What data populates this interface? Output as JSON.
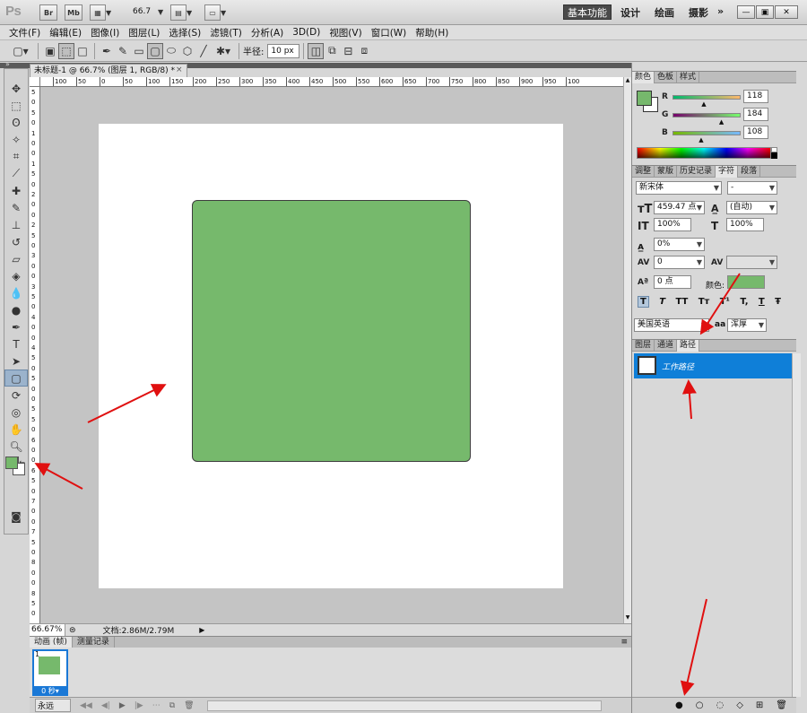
{
  "app": {
    "logo": "Ps",
    "bridge_btn": "Br",
    "mini_bridge_btn": "Mb",
    "zoom_value": "66.7",
    "workspaces": {
      "active": "基本功能",
      "design": "设计",
      "painting": "绘画",
      "photography": "摄影",
      "more": "»"
    }
  },
  "menu": [
    "文件(F)",
    "编辑(E)",
    "图像(I)",
    "图层(L)",
    "选择(S)",
    "滤镜(T)",
    "分析(A)",
    "3D(D)",
    "视图(V)",
    "窗口(W)",
    "帮助(H)"
  ],
  "options": {
    "radius_label": "半径:",
    "radius_value": "10 px"
  },
  "document": {
    "tab_title": "未标题-1 @ 66.7% (图层 1, RGB/8) *",
    "close": "×",
    "ruler_h": [
      "100",
      "50",
      "0",
      "50",
      "100",
      "150",
      "200",
      "250",
      "300",
      "350",
      "400",
      "450",
      "500",
      "550",
      "600",
      "650",
      "700",
      "750",
      "800",
      "850",
      "900",
      "950",
      "100"
    ],
    "ruler_v": [
      "5",
      "0",
      "5",
      "0",
      "1",
      "0",
      "0",
      "1",
      "5",
      "0",
      "2",
      "0",
      "0",
      "2",
      "5",
      "0",
      "3",
      "0",
      "0",
      "3",
      "5",
      "0",
      "4",
      "0",
      "0",
      "4",
      "5",
      "0",
      "5",
      "0",
      "0",
      "5",
      "5",
      "0",
      "6",
      "0",
      "0",
      "6",
      "5",
      "0",
      "7",
      "0",
      "0",
      "7",
      "5",
      "0",
      "8",
      "0",
      "0",
      "8",
      "5",
      "0"
    ],
    "shape_color": "#76b96c"
  },
  "status": {
    "zoom": "66.67%",
    "doc_info": "文档:2.86M/2.79M"
  },
  "animation": {
    "tabs": [
      "动画 (帧)",
      "测量记录"
    ],
    "frame_number": "1",
    "frame_time": "0 秒▾",
    "loop": "永远"
  },
  "color_panel": {
    "tabs": [
      "颜色",
      "色板",
      "样式"
    ],
    "r_label": "R",
    "g_label": "G",
    "b_label": "B",
    "r": "118",
    "g": "184",
    "b": "108",
    "r_level": 0.463,
    "g_level": 0.722,
    "b_level": 0.424,
    "swatch": "#76b86c"
  },
  "char_panel": {
    "tabs": [
      "调整",
      "蒙版",
      "历史记录",
      "字符",
      "段落"
    ],
    "font_family": "新宋体",
    "font_style": "-",
    "size": "459.47 点",
    "leading": "(自动)",
    "vscale": "100%",
    "hscale": "100%",
    "tsume": "0%",
    "tracking": "0",
    "kerning": "",
    "baseline": "0 点",
    "color_label": "颜色:",
    "text_color": "#76b96c",
    "style_buttons": [
      "T",
      "T",
      "TT",
      "Tт",
      "T¹",
      "T,",
      "T",
      "Ŧ"
    ],
    "language": "美国英语",
    "aa_label": "aa",
    "antialias": "浑厚"
  },
  "paths_panel": {
    "tabs": [
      "图层",
      "通道",
      "路径"
    ],
    "path_name": "工作路径"
  }
}
